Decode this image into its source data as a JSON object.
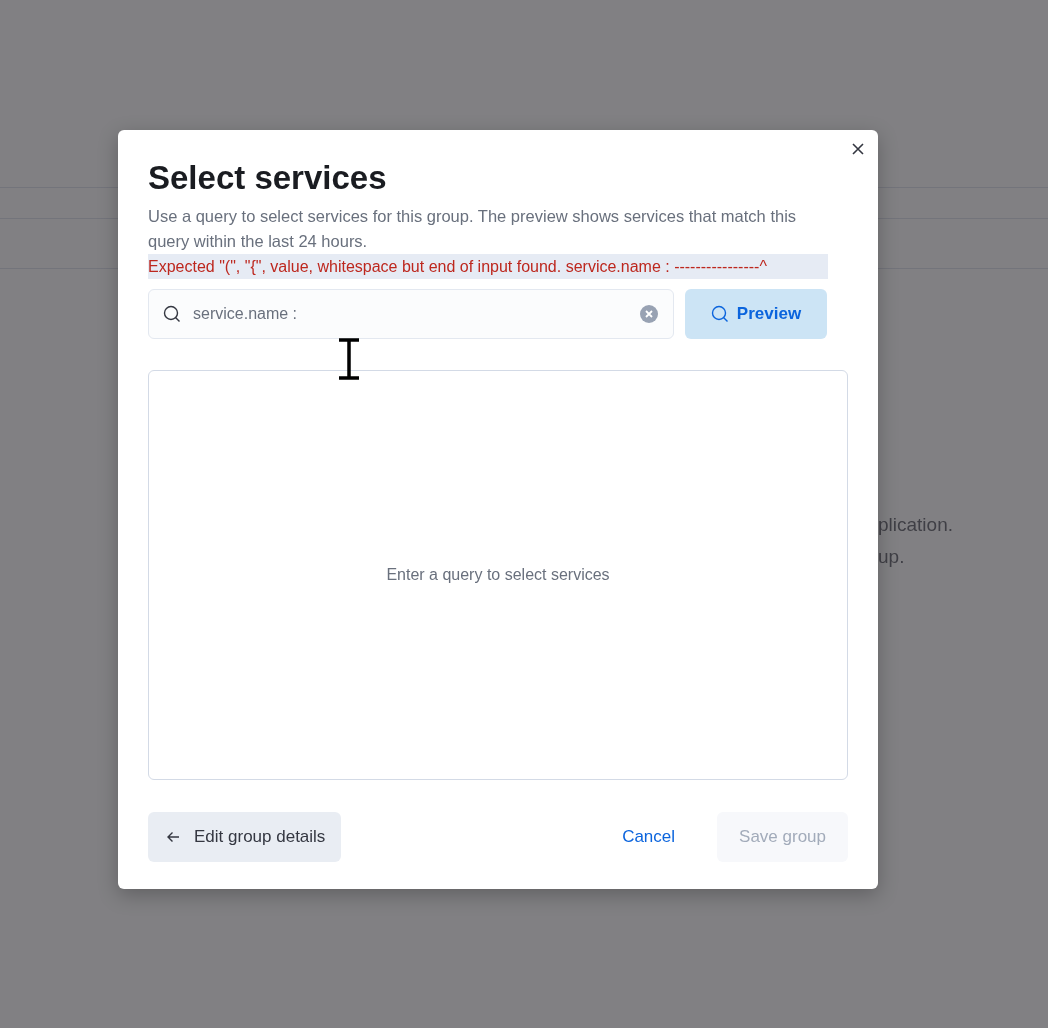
{
  "background": {
    "lines": [
      "plication.",
      "up."
    ]
  },
  "modal": {
    "title": "Select services",
    "description": "Use a query to select services for this group. The preview shows services that match this query within the last 24 hours.",
    "error": "Expected \"(\", \"{\", value, whitespace but end of input found. service.name : ----------------^",
    "query": {
      "value": "service.name :"
    },
    "preview_button": "Preview",
    "empty_message": "Enter a query to select services",
    "footer": [
      {
        "label": "Edit group details",
        "kind": "back"
      },
      {
        "label": "Cancel",
        "kind": "link",
        "disabled": false
      },
      {
        "label": "Save group",
        "kind": "primary",
        "disabled": true
      }
    ]
  }
}
